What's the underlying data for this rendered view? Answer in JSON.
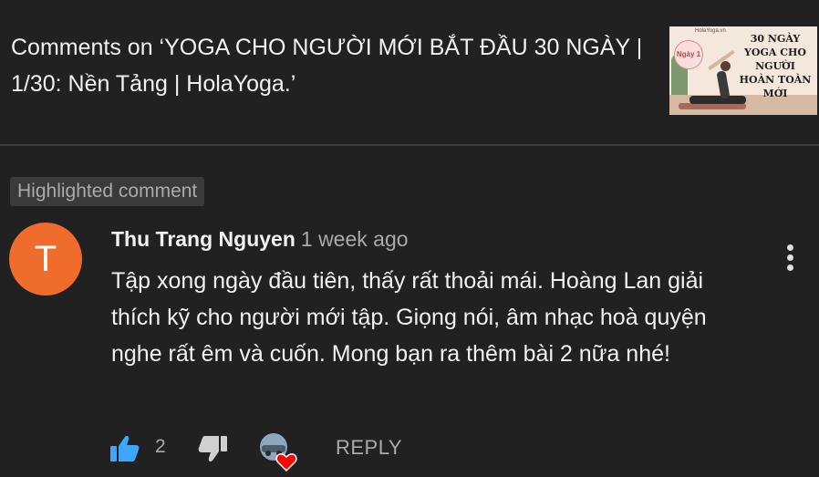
{
  "header": {
    "title": "Comments on ‘YOGA CHO NGƯỜI MỚI BẮT ĐẦU 30 NGÀY | 1/30: Nền Tảng | HolaYoga.’",
    "thumbnail": {
      "site": "HolaYoga.vn",
      "day_badge": "Ngày 1",
      "text": "30 NGÀY YOGA CHO NGƯỜI HOÀN TOÀN MỚI"
    }
  },
  "badge": {
    "label": "Highlighted comment"
  },
  "comment": {
    "avatar_letter": "T",
    "author": "Thu Trang Nguyen",
    "timestamp": "1 week ago",
    "text": "Tập xong ngày đầu tiên, thấy rất thoải mái. Hoàng Lan giải thích kỹ cho người mới tập. Giọng nói, âm nhạc hoà quyện nghe rất êm và cuốn. Mong bạn ra thêm bài 2 nữa nhé!",
    "like_count": "2",
    "reply_label": "REPLY"
  },
  "icons": {
    "like": "thumbs-up-icon",
    "dislike": "thumbs-down-icon",
    "menu": "vertical-dots-icon",
    "heart": "creator-heart-icon"
  },
  "colors": {
    "background": "#212121",
    "avatar": "#ef6c2c",
    "like_active": "#3ea6ff",
    "heart": "#ff0000",
    "secondary_text": "#aaaaaa"
  }
}
